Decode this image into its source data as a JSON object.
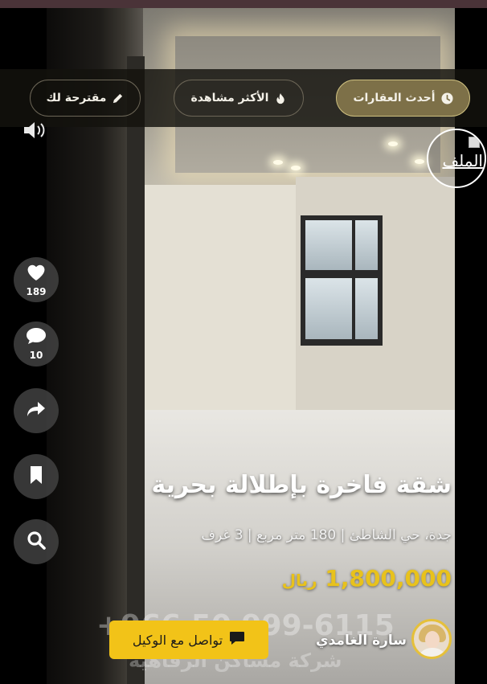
{
  "tabs": [
    {
      "label": "أحدث العقارات",
      "icon": "clock-icon",
      "active": true
    },
    {
      "label": "الأكثر مشاهدة",
      "icon": "fire-icon",
      "active": false
    },
    {
      "label": "مقترحة لك",
      "icon": "pencil-icon",
      "active": false
    }
  ],
  "profile": {
    "alt_text": "الملف"
  },
  "actions": {
    "likes": "189",
    "comments": "10"
  },
  "listing": {
    "title": "شقة فاخرة بإطلالة بحرية",
    "details": "جدة، حي الشاطئ | 180 متر مربع | 3 غرف",
    "price": "1,800,000",
    "currency": "ريال"
  },
  "watermark": {
    "phone": "+966 50 999-6115",
    "company": "شركة مساكن الرفاهية"
  },
  "agent": {
    "name": "سارة الغامدي",
    "contact_label": "تواصل مع الوكيل"
  },
  "colors": {
    "accent": "#f2c318",
    "price": "#e8c21c",
    "active_tab": "#7d7048"
  }
}
